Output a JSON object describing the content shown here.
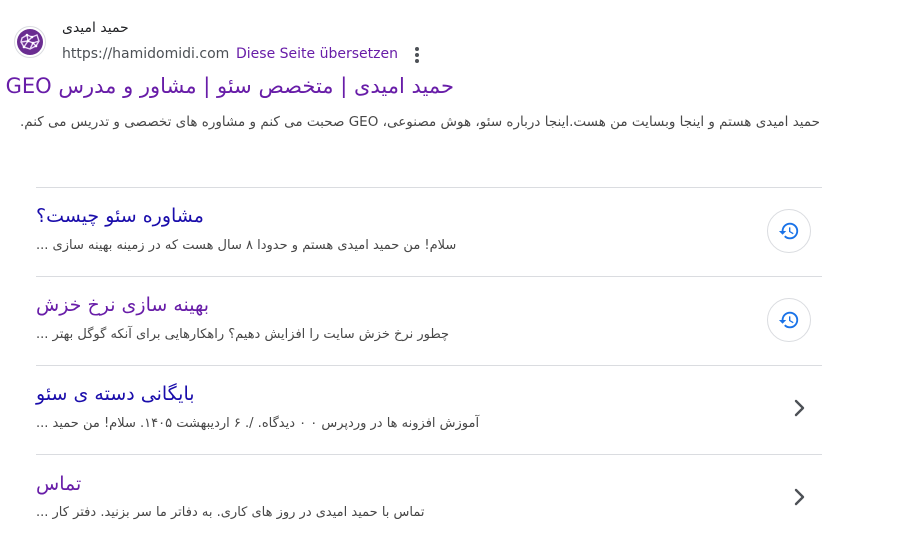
{
  "result": {
    "site_name": "حمید امیدی",
    "url": "https://hamidomidi.com",
    "separator": "·",
    "translate_label": "Diese Seite übersetzen",
    "title": "حمید امیدی | متخصص سئو | مشاور و مدرس GEO",
    "snippet": "حمید امیدی هستم و اینجا وبسایت من هست.اینجا درباره سئو، هوش مصنوعی، GEO صحبت می کنم و مشاوره های تخصصی و تدریس می کنم.",
    "favicon_icon": "favicon-network-icon",
    "menu_icon": "more-vert-icon"
  },
  "sitelinks": [
    {
      "title": "مشاوره سئو چیست؟",
      "description": "سلام! من حمید امیدی هستم و حدودا ۸ سال هست که در زمینه بهینه سازی ...",
      "visited": false,
      "icon": "history-icon"
    },
    {
      "title": "بهینه سازی نرخ خزش",
      "description": "چطور نرخ خزش سایت را افزایش دهیم؟ راهکارهایی برای آنکه گوگل بهتر ...",
      "visited": true,
      "icon": "history-icon"
    },
    {
      "title": "بایگانی دسته ی سئو",
      "description": "آموزش افزونه ها در وردپرس ۰ ۰ دیدگاه. /. ۶ اردیبهشت ۱۴۰۵. سلام! من حمید ...",
      "visited": false,
      "icon": "chevron-right-icon"
    },
    {
      "title": "تماس",
      "description": "تماس با حمید امیدی در روز های کاری. به دفاتر ما سر بزنید. دفتر کار ...",
      "visited": true,
      "icon": "chevron-right-icon"
    }
  ],
  "colors": {
    "visited_link": "#681da8",
    "unvisited_link": "#1a0dab",
    "history_icon": "#1a73e8",
    "favicon": "#6a2c91"
  }
}
